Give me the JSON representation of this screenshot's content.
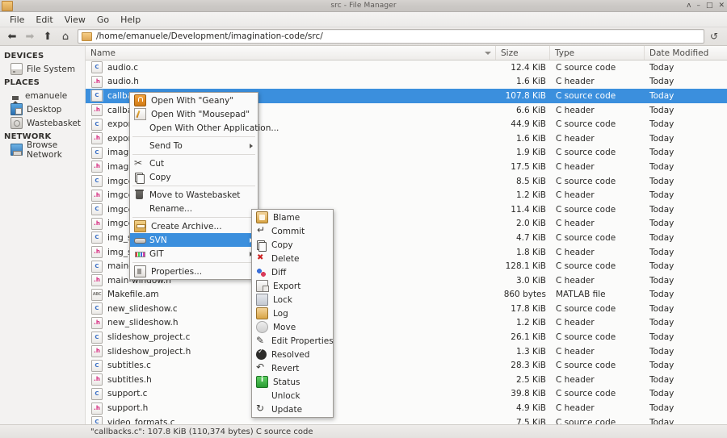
{
  "window": {
    "title": "src - File Manager",
    "app_icon": "folder-icon",
    "controls": {
      "shade": "ʌ",
      "minimize": "–",
      "maximize": "□",
      "close": "✕"
    }
  },
  "menubar": {
    "items": [
      "File",
      "Edit",
      "View",
      "Go",
      "Help"
    ]
  },
  "toolbar": {
    "back": "⬅",
    "forward": "➡",
    "up": "⬆",
    "home": "⌂",
    "reload": "↺",
    "path": "/home/emanuele/Development/imagination-code/src/"
  },
  "sidebar": {
    "groups": [
      {
        "title": "DEVICES",
        "items": [
          {
            "label": "File System",
            "icon": "drive-icon"
          }
        ]
      },
      {
        "title": "PLACES",
        "items": [
          {
            "label": "emanuele",
            "icon": "home-icon"
          },
          {
            "label": "Desktop",
            "icon": "desktop-icon"
          },
          {
            "label": "Wastebasket",
            "icon": "trash-icon"
          }
        ]
      },
      {
        "title": "NETWORK",
        "items": [
          {
            "label": "Browse Network",
            "icon": "network-icon"
          }
        ]
      }
    ]
  },
  "filelist": {
    "columns": {
      "name": "Name",
      "size": "Size",
      "type": "Type",
      "date": "Date Modified"
    },
    "sort_indicator": "descending",
    "rows": [
      {
        "name": "audio.c",
        "icon": "c",
        "size": "12.4 KiB",
        "type": "C source code",
        "date": "Today",
        "selected": false
      },
      {
        "name": "audio.h",
        "icon": "h",
        "size": "1.6 KiB",
        "type": "C header",
        "date": "Today",
        "selected": false
      },
      {
        "name": "callbacks.c",
        "icon": "c",
        "size": "107.8 KiB",
        "type": "C source code",
        "date": "Today",
        "selected": true
      },
      {
        "name": "callbacks.h",
        "icon": "h",
        "size": "6.6 KiB",
        "type": "C header",
        "date": "Today",
        "selected": false
      },
      {
        "name": "export.c",
        "icon": "c",
        "size": "44.9 KiB",
        "type": "C source code",
        "date": "Today",
        "selected": false
      },
      {
        "name": "export.h",
        "icon": "h",
        "size": "1.6 KiB",
        "type": "C header",
        "date": "Today",
        "selected": false
      },
      {
        "name": "imagination.c",
        "icon": "c",
        "size": "1.9 KiB",
        "type": "C source code",
        "date": "Today",
        "selected": false
      },
      {
        "name": "imagination.h",
        "icon": "h",
        "size": "17.5 KiB",
        "type": "C header",
        "date": "Today",
        "selected": false
      },
      {
        "name": "imgcellrenderer.c",
        "icon": "c",
        "size": "8.5 KiB",
        "type": "C source code",
        "date": "Today",
        "selected": false
      },
      {
        "name": "imgcellrenderer.h",
        "icon": "h",
        "size": "1.2 KiB",
        "type": "C header",
        "date": "Today",
        "selected": false
      },
      {
        "name": "imgcellrendererpixbuf.c",
        "icon": "c",
        "size": "11.4 KiB",
        "type": "C source code",
        "date": "Today",
        "selected": false
      },
      {
        "name": "imgcellrendererpixbuf.h",
        "icon": "h",
        "size": "2.0 KiB",
        "type": "C header",
        "date": "Today",
        "selected": false
      },
      {
        "name": "img_sox.c",
        "icon": "c",
        "size": "4.7 KiB",
        "type": "C source code",
        "date": "Today",
        "selected": false
      },
      {
        "name": "img_sox.h",
        "icon": "h",
        "size": "1.8 KiB",
        "type": "C header",
        "date": "Today",
        "selected": false
      },
      {
        "name": "main-window.c",
        "icon": "c",
        "size": "128.1 KiB",
        "type": "C source code",
        "date": "Today",
        "selected": false
      },
      {
        "name": "main-window.h",
        "icon": "h",
        "size": "3.0 KiB",
        "type": "C header",
        "date": "Today",
        "selected": false
      },
      {
        "name": "Makefile.am",
        "icon": "m",
        "size": "860 bytes",
        "type": "MATLAB file",
        "date": "Today",
        "selected": false
      },
      {
        "name": "new_slideshow.c",
        "icon": "c",
        "size": "17.8 KiB",
        "type": "C source code",
        "date": "Today",
        "selected": false
      },
      {
        "name": "new_slideshow.h",
        "icon": "h",
        "size": "1.2 KiB",
        "type": "C header",
        "date": "Today",
        "selected": false
      },
      {
        "name": "slideshow_project.c",
        "icon": "c",
        "size": "26.1 KiB",
        "type": "C source code",
        "date": "Today",
        "selected": false
      },
      {
        "name": "slideshow_project.h",
        "icon": "h",
        "size": "1.3 KiB",
        "type": "C header",
        "date": "Today",
        "selected": false
      },
      {
        "name": "subtitles.c",
        "icon": "c",
        "size": "28.3 KiB",
        "type": "C source code",
        "date": "Today",
        "selected": false
      },
      {
        "name": "subtitles.h",
        "icon": "h",
        "size": "2.5 KiB",
        "type": "C header",
        "date": "Today",
        "selected": false
      },
      {
        "name": "support.c",
        "icon": "c",
        "size": "39.8 KiB",
        "type": "C source code",
        "date": "Today",
        "selected": false
      },
      {
        "name": "support.h",
        "icon": "h",
        "size": "4.9 KiB",
        "type": "C header",
        "date": "Today",
        "selected": false
      },
      {
        "name": "video_formats.c",
        "icon": "c",
        "size": "7.5 KiB",
        "type": "C source code",
        "date": "Today",
        "selected": false
      }
    ]
  },
  "statusbar": {
    "text": "\"callbacks.c\": 107.8  KiB (110,374 bytes) C source code"
  },
  "context_menu": {
    "items": [
      {
        "label": "Open With \"Geany\"",
        "icon": "geany-icon",
        "submenu": false,
        "sep_after": false
      },
      {
        "label": "Open With \"Mousepad\"",
        "icon": "mousepad-icon",
        "submenu": false,
        "sep_after": false
      },
      {
        "label": "Open With Other Application...",
        "icon": "",
        "submenu": false,
        "sep_after": true
      },
      {
        "label": "Send To",
        "icon": "",
        "submenu": true,
        "sep_after": true
      },
      {
        "label": "Cut",
        "icon": "cut-icon",
        "submenu": false,
        "sep_after": false
      },
      {
        "label": "Copy",
        "icon": "copy-icon",
        "submenu": false,
        "sep_after": true
      },
      {
        "label": "Move to Wastebasket",
        "icon": "trash-icon",
        "submenu": false,
        "sep_after": false
      },
      {
        "label": "Rename...",
        "icon": "",
        "submenu": false,
        "sep_after": true
      },
      {
        "label": "Create Archive...",
        "icon": "archive-icon",
        "submenu": false,
        "sep_after": false
      },
      {
        "label": "SVN",
        "icon": "svn-icon",
        "submenu": true,
        "sep_after": false,
        "highlighted": true
      },
      {
        "label": "GIT",
        "icon": "git-icon",
        "submenu": true,
        "sep_after": true
      },
      {
        "label": "Properties...",
        "icon": "props-icon",
        "submenu": false,
        "sep_after": false
      }
    ]
  },
  "svn_submenu": {
    "items": [
      {
        "label": "Blame",
        "icon": "blame-icon"
      },
      {
        "label": "Commit",
        "icon": "commit-icon"
      },
      {
        "label": "Copy",
        "icon": "copy-icon"
      },
      {
        "label": "Delete",
        "icon": "delete-icon"
      },
      {
        "label": "Diff",
        "icon": "diff-icon"
      },
      {
        "label": "Export",
        "icon": "export-icon"
      },
      {
        "label": "Lock",
        "icon": "lock-icon"
      },
      {
        "label": "Log",
        "icon": "log-icon"
      },
      {
        "label": "Move",
        "icon": "move-icon"
      },
      {
        "label": "Edit Properties",
        "icon": "editprops-icon"
      },
      {
        "label": "Resolved",
        "icon": "resolved-icon"
      },
      {
        "label": "Revert",
        "icon": "revert-icon"
      },
      {
        "label": "Status",
        "icon": "status-icon"
      },
      {
        "label": "Unlock",
        "icon": ""
      },
      {
        "label": "Update",
        "icon": "update-icon"
      }
    ]
  },
  "colors": {
    "selection": "#3b8fdd",
    "chrome": "#f2f1f0",
    "pane": "#fbfbfa"
  }
}
